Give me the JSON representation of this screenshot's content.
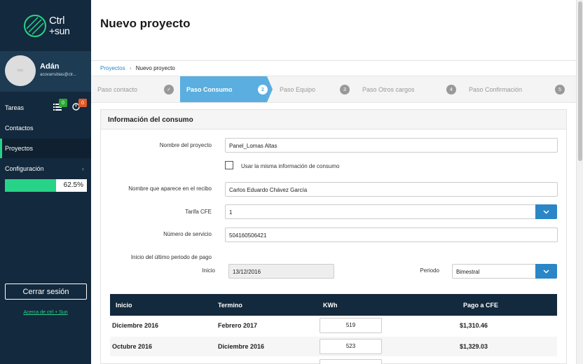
{
  "brand": {
    "line1": "Ctrl",
    "line2": "+sun"
  },
  "profile": {
    "name": "Adán",
    "email": "acovarrubias@ctr...",
    "avatar_text": "foto"
  },
  "nav": {
    "tasks": "Tareas",
    "tasks_badge1": "0",
    "tasks_badge2": "0",
    "contacts": "Contactos",
    "projects": "Proyectos",
    "config": "Configuración"
  },
  "progress": {
    "value": 0.625,
    "label": "62.5%"
  },
  "sidebar_footer": {
    "logout": "Cerrar sesión",
    "about": "Acerca de ctrl + Sun"
  },
  "page": {
    "title": "Nuevo proyecto"
  },
  "breadcrumb": {
    "root": "Proyectos",
    "sep": "›",
    "current": "Nuevo proyecto"
  },
  "steps": [
    {
      "label": "Paso contacto",
      "num": "✓"
    },
    {
      "label": "Paso Consumo",
      "num": "2"
    },
    {
      "label": "Paso Equipo",
      "num": "3"
    },
    {
      "label": "Paso Otros cargos",
      "num": "4"
    },
    {
      "label": "Paso Confirmación",
      "num": "5"
    }
  ],
  "form": {
    "section_title": "Información del consumo",
    "project_name_label": "Nombre del proyecto",
    "project_name_value": "Panel_Lomas Altas",
    "same_info_label": "Usar la misma información de consumo",
    "receipt_name_label": "Nombre que aparece en el recibo",
    "receipt_name_value": "Carlos Eduardo Chávez García",
    "tariff_label": "Tarifa CFE",
    "tariff_value": "1",
    "service_label": "Número de servicio",
    "service_value": "504160506421",
    "period_start_label": "Inicio del último periodo de pago",
    "start_label": "Inicio",
    "start_value": "13/12/2016",
    "period_label": "Periodo",
    "period_value": "Bimestral"
  },
  "table": {
    "headers": [
      "Inicio",
      "Termino",
      "KWh",
      "Pago a CFE"
    ],
    "rows": [
      [
        "Diciembre 2016",
        "Febrero 2017",
        "519",
        "$1,310.46"
      ],
      [
        "Octubre 2016",
        "Diciembre 2016",
        "523",
        "$1,329.03"
      ]
    ]
  },
  "colors": {
    "sidebar": "#13293d",
    "accent": "#27d487",
    "active_step": "#5aaee0",
    "primary": "#2a86c7"
  }
}
